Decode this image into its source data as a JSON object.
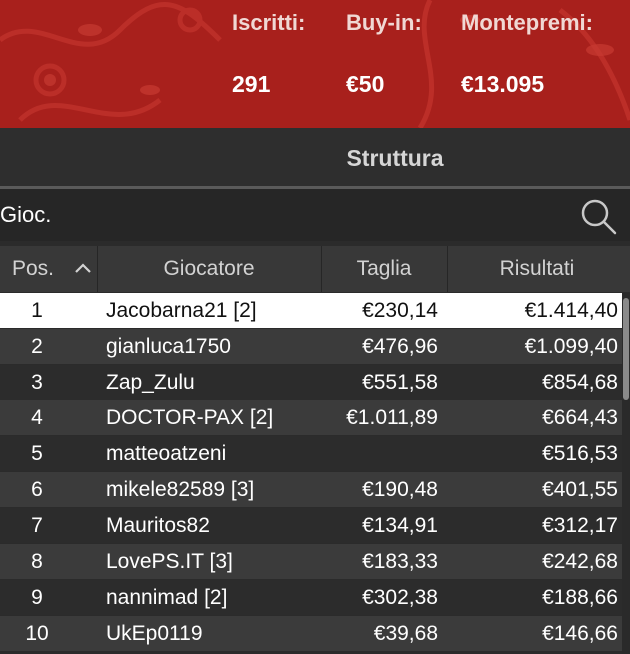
{
  "tournament": {
    "entrants_label": "Iscritti:",
    "entrants_value": "291",
    "buyin_label": "Buy-in:",
    "buyin_value": "€50",
    "prize_label": "Montepremi:",
    "prize_value": "€13.095"
  },
  "section": {
    "title": "Struttura"
  },
  "search": {
    "value": "Gioc.",
    "icon": "search-icon"
  },
  "table": {
    "headers": {
      "pos": "Pos.",
      "player": "Giocatore",
      "bounty": "Taglia",
      "results": "Risultati"
    },
    "sort_icon": "chevron-up-icon",
    "rows": [
      {
        "pos": "1",
        "player": "Jacobarna21 [2]",
        "bounty": "€230,14",
        "result": "€1.414,40"
      },
      {
        "pos": "2",
        "player": "gianluca1750",
        "bounty": "€476,96",
        "result": "€1.099,40"
      },
      {
        "pos": "3",
        "player": "Zap_Zulu",
        "bounty": "€551,58",
        "result": "€854,68"
      },
      {
        "pos": "4",
        "player": "DOCTOR-PAX [2]",
        "bounty": "€1.011,89",
        "result": "€664,43"
      },
      {
        "pos": "5",
        "player": "matteoatzeni",
        "bounty": "",
        "result": "€516,53"
      },
      {
        "pos": "6",
        "player": "mikele82589 [3]",
        "bounty": "€190,48",
        "result": "€401,55"
      },
      {
        "pos": "7",
        "player": "Mauritos82",
        "bounty": "€134,91",
        "result": "€312,17"
      },
      {
        "pos": "8",
        "player": "LovePS.IT [3]",
        "bounty": "€183,33",
        "result": "€242,68"
      },
      {
        "pos": "9",
        "player": "nannimad [2]",
        "bounty": "€302,38",
        "result": "€188,66"
      },
      {
        "pos": "10",
        "player": "UkEp0119",
        "bounty": "€39,68",
        "result": "€146,66"
      }
    ]
  },
  "colors": {
    "banner": "#a8201c",
    "selected_row": "#ffffff",
    "header": "#383838"
  }
}
